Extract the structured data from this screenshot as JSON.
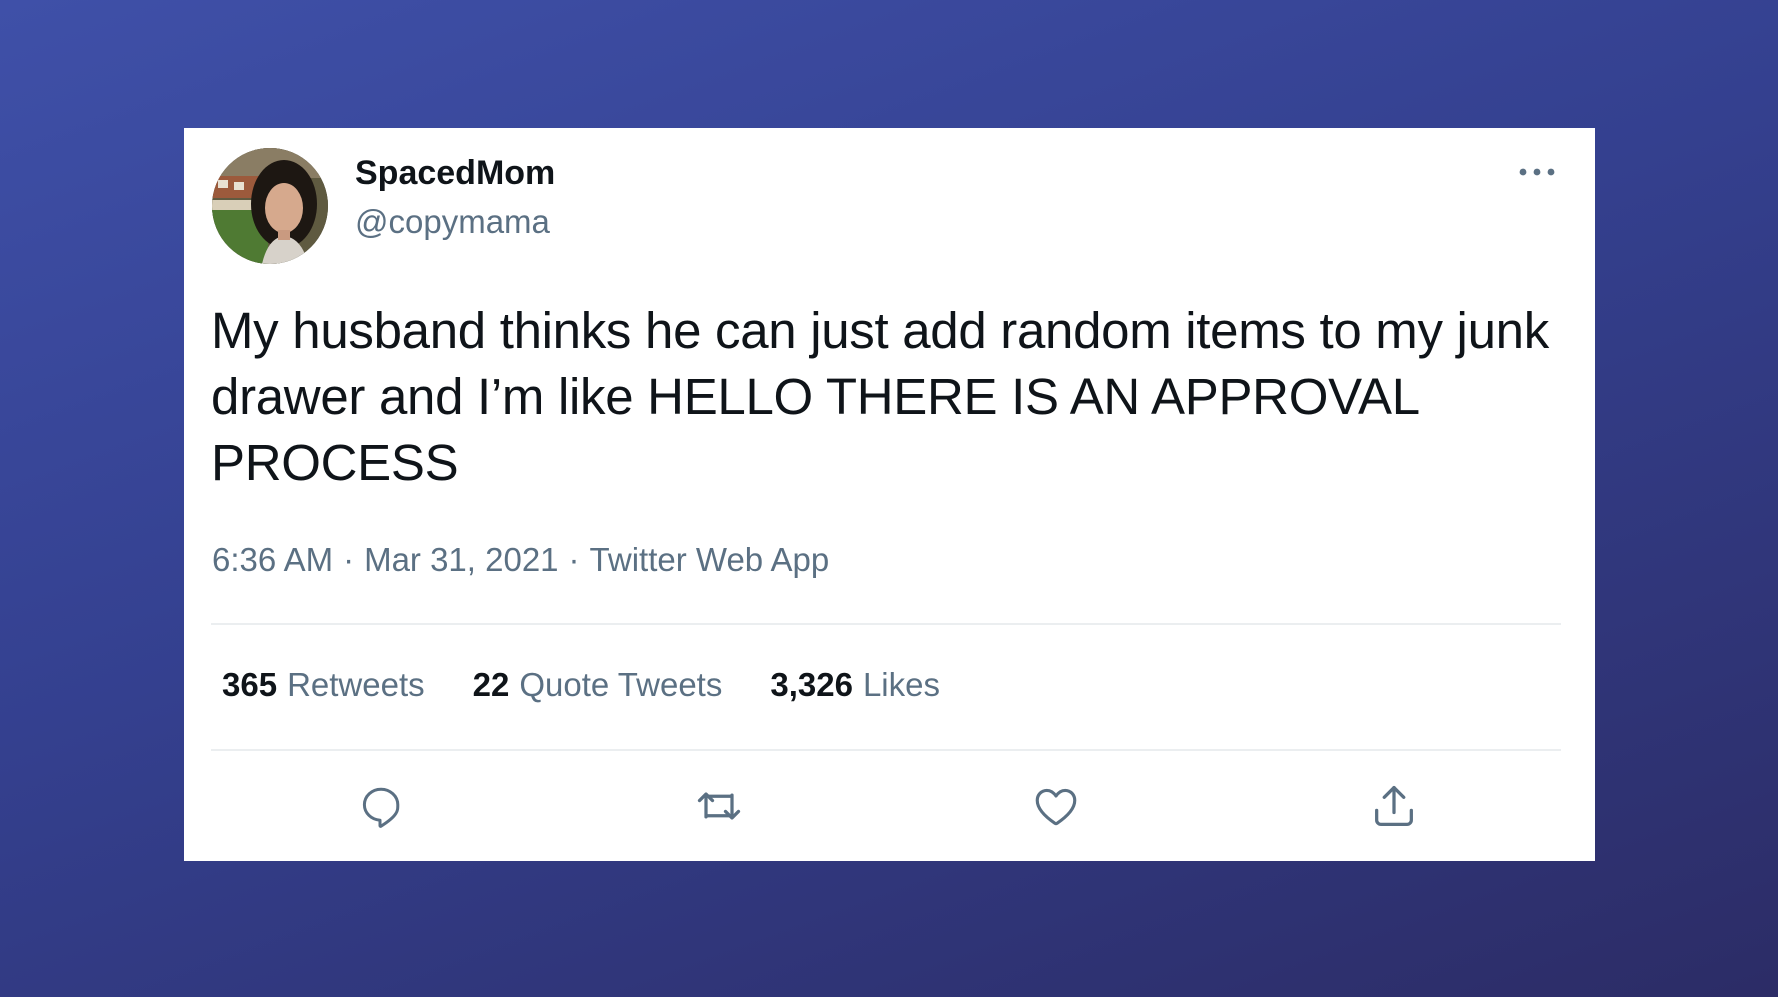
{
  "tweet": {
    "display_name": "SpacedMom",
    "handle": "@copymama",
    "text": "My husband thinks he can just add random items to my junk drawer and I’m like HELLO THERE IS AN APPROVAL PROCESS",
    "time": "6:36 AM",
    "date": "Mar 31, 2021",
    "source": "Twitter Web App",
    "separator": "·"
  },
  "stats": [
    {
      "count": "365",
      "label": "Retweets"
    },
    {
      "count": "22",
      "label": "Quote Tweets"
    },
    {
      "count": "3,326",
      "label": "Likes"
    }
  ],
  "icons": {
    "more": "more-horizontal-icon",
    "reply": "reply-icon",
    "retweet": "retweet-icon",
    "like": "heart-icon",
    "share": "share-icon"
  },
  "colors": {
    "primary_text": "#0f1419",
    "secondary_text": "#5b7083",
    "divider": "#ebeef0",
    "background_start": "#3f50a8",
    "background_end": "#2c2c66",
    "card": "#ffffff"
  }
}
